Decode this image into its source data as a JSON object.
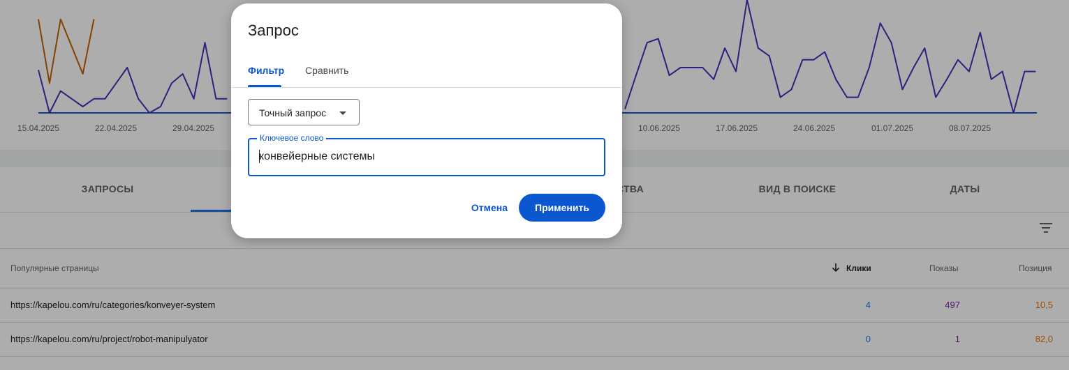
{
  "chart": {
    "dates": [
      "15.04.2025",
      "22.04.2025",
      "29.04.2025",
      "10.06.2025",
      "17.06.2025",
      "24.06.2025",
      "01.07.2025",
      "08.07.2025"
    ],
    "colors": {
      "clicks": "#4a2db5",
      "impressions": "#c56000",
      "baseline": "#1a55d0"
    },
    "chart_data": {
      "type": "line",
      "series": [
        {
          "values": [
            55,
            0,
            28,
            18,
            8,
            18,
            18,
            38,
            58,
            18,
            0,
            8,
            38,
            50,
            18,
            90,
            18,
            18
          ]
        },
        {
          "values": [
            120,
            38,
            120,
            85,
            50,
            120
          ]
        },
        {
          "values": [
            5,
            48,
            90,
            95,
            48,
            58,
            58,
            58,
            43,
            83,
            53,
            145,
            83,
            73,
            20,
            30,
            68,
            68,
            78,
            43,
            20,
            20,
            58,
            115,
            90,
            30,
            58,
            83,
            20,
            43,
            68,
            53,
            103,
            43,
            53,
            0,
            53,
            53
          ]
        }
      ]
    }
  },
  "tabs": [
    {
      "label": "ЗАПРОСЫ"
    },
    {
      "label": ""
    },
    {
      "label": "СТВА"
    },
    {
      "label": "ВИД В ПОИСКЕ"
    },
    {
      "label": "ДАТЫ"
    }
  ],
  "table": {
    "headers": {
      "page": "Популярные страницы",
      "clicks": "Клики",
      "impressions": "Показы",
      "position": "Позиция"
    },
    "rows": [
      {
        "url": "https://kapelou.com/ru/categories/konveyer-system",
        "clicks": "4",
        "impressions": "497",
        "position": "10,5"
      },
      {
        "url": "https://kapelou.com/ru/project/robot-manipulyator",
        "clicks": "0",
        "impressions": "1",
        "position": "82,0"
      }
    ],
    "colors": {
      "clicks": "#1a73e8",
      "impressions": "#7b1fa2",
      "position": "#e8710a"
    }
  },
  "dialog": {
    "title": "Запрос",
    "tab_filter": "Фильтр",
    "tab_compare": "Сравнить",
    "match_type": "Точный запрос",
    "keyword_label": "Ключевое слово",
    "keyword_value": "конвейерные системы",
    "cancel": "Отмена",
    "apply": "Применить"
  },
  "icons": {
    "filter": "filter-list-icon",
    "sort": "arrow-down-icon",
    "dropdown": "caret-down-icon"
  }
}
